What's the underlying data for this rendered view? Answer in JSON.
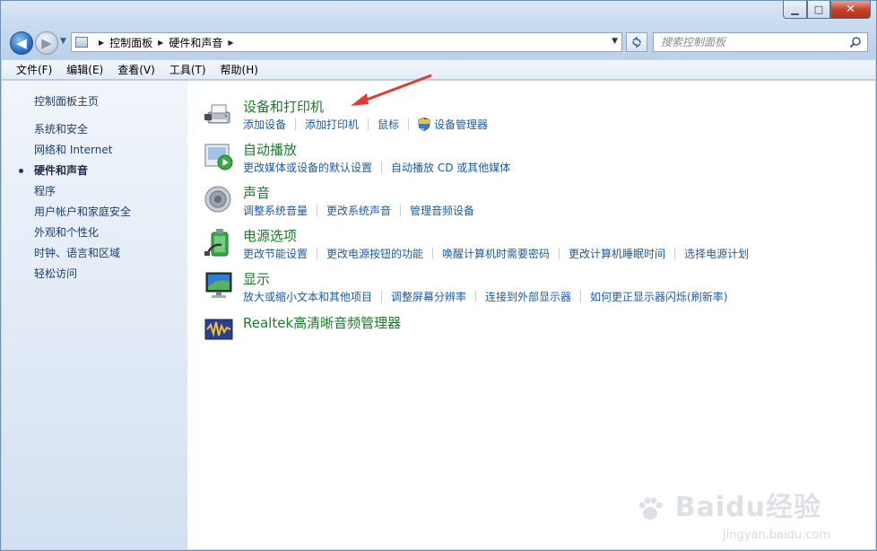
{
  "window": {
    "minimize_glyph": "▁",
    "maximize_glyph": "□",
    "close_glyph": "✕"
  },
  "nav": {
    "back_glyph": "◀",
    "forward_glyph": "▶",
    "breadcrumbs": [
      "控制面板",
      "硬件和声音"
    ],
    "search_placeholder": "搜索控制面板"
  },
  "menubar": {
    "items": [
      "文件(F)",
      "编辑(E)",
      "查看(V)",
      "工具(T)",
      "帮助(H)"
    ]
  },
  "sidebar": {
    "home": "控制面板主页",
    "items": [
      {
        "label": "系统和安全",
        "active": false
      },
      {
        "label": "网络和 Internet",
        "active": false
      },
      {
        "label": "硬件和声音",
        "active": true
      },
      {
        "label": "程序",
        "active": false
      },
      {
        "label": "用户帐户和家庭安全",
        "active": false
      },
      {
        "label": "外观和个性化",
        "active": false
      },
      {
        "label": "时钟、语言和区域",
        "active": false
      },
      {
        "label": "轻松访问",
        "active": false
      }
    ]
  },
  "groups": [
    {
      "title": "设备和打印机",
      "icon": "printer-icon",
      "links": [
        "添加设备",
        "添加打印机",
        "鼠标",
        "设备管理器"
      ]
    },
    {
      "title": "自动播放",
      "icon": "autoplay-icon",
      "links": [
        "更改媒体或设备的默认设置",
        "自动播放 CD 或其他媒体"
      ]
    },
    {
      "title": "声音",
      "icon": "speaker-icon",
      "links": [
        "调整系统音量",
        "更改系统声音",
        "管理音频设备"
      ]
    },
    {
      "title": "电源选项",
      "icon": "battery-icon",
      "links": [
        "更改节能设置",
        "更改电源按钮的功能",
        "唤醒计算机时需要密码",
        "更改计算机睡眠时间",
        "选择电源计划"
      ]
    },
    {
      "title": "显示",
      "icon": "monitor-icon",
      "links": [
        "放大或缩小文本和其他项目",
        "调整屏幕分辨率",
        "连接到外部显示器",
        "如何更正显示器闪烁(刷新率)"
      ]
    },
    {
      "title": "Realtek高清晰音频管理器",
      "icon": "realtek-icon",
      "links": []
    }
  ],
  "watermark": {
    "brand": "Baidu经验",
    "url": "jingyan.baidu.com"
  },
  "colors": {
    "group_title": "#1a7b2a",
    "link": "#1b5ca3",
    "annotation_arrow": "#e53935"
  }
}
